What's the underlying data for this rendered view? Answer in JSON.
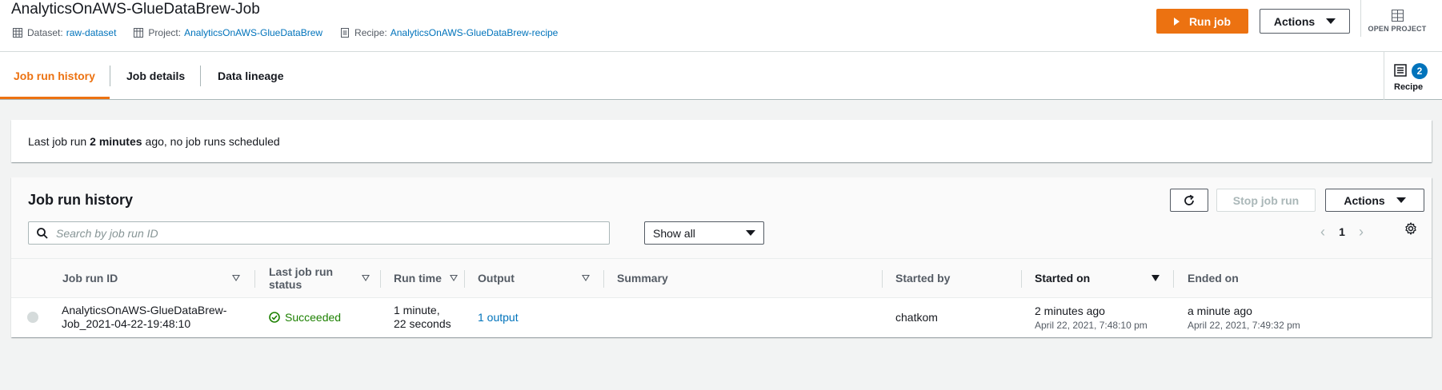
{
  "header": {
    "title": "AnalyticsOnAWS-GlueDataBrew-Job",
    "dataset_label": "Dataset:",
    "dataset_value": "raw-dataset",
    "project_label": "Project:",
    "project_value": "AnalyticsOnAWS-GlueDataBrew",
    "recipe_label": "Recipe:",
    "recipe_value": "AnalyticsOnAWS-GlueDataBrew-recipe",
    "run_job": "Run job",
    "actions": "Actions",
    "open_project": "OPEN PROJECT"
  },
  "tabs": [
    {
      "label": "Job run history",
      "active": true
    },
    {
      "label": "Job details",
      "active": false
    },
    {
      "label": "Data lineage",
      "active": false
    }
  ],
  "recipe_panel": {
    "label": "Recipe",
    "count": "2"
  },
  "info": {
    "prefix": "Last job run",
    "emphasis": "2 minutes",
    "suffix": "ago, no job runs scheduled"
  },
  "history": {
    "title": "Job run history",
    "stop_job_run": "Stop job run",
    "actions": "Actions",
    "search_placeholder": "Search by job run ID",
    "filter_value": "Show all",
    "page": "1",
    "columns": [
      "Job run ID",
      "Last job run status",
      "Run time",
      "Output",
      "Summary",
      "Started by",
      "Started on",
      "Ended on"
    ],
    "rows": [
      {
        "job_run_id_line1": "AnalyticsOnAWS-GlueDataBrew-",
        "job_run_id_line2": "Job_2021-04-22-19:48:10",
        "status": "Succeeded",
        "run_time_line1": "1 minute,",
        "run_time_line2": "22 seconds",
        "output": "1 output",
        "summary": "",
        "started_by": "chatkom",
        "started_on": "2 minutes ago",
        "started_on_detail": "April 22, 2021, 7:48:10 pm",
        "ended_on": "a minute ago",
        "ended_on_detail": "April 22, 2021, 7:49:32 pm"
      }
    ]
  },
  "colors": {
    "accent": "#ec7211",
    "link": "#0073bb",
    "success": "#1d8102"
  }
}
